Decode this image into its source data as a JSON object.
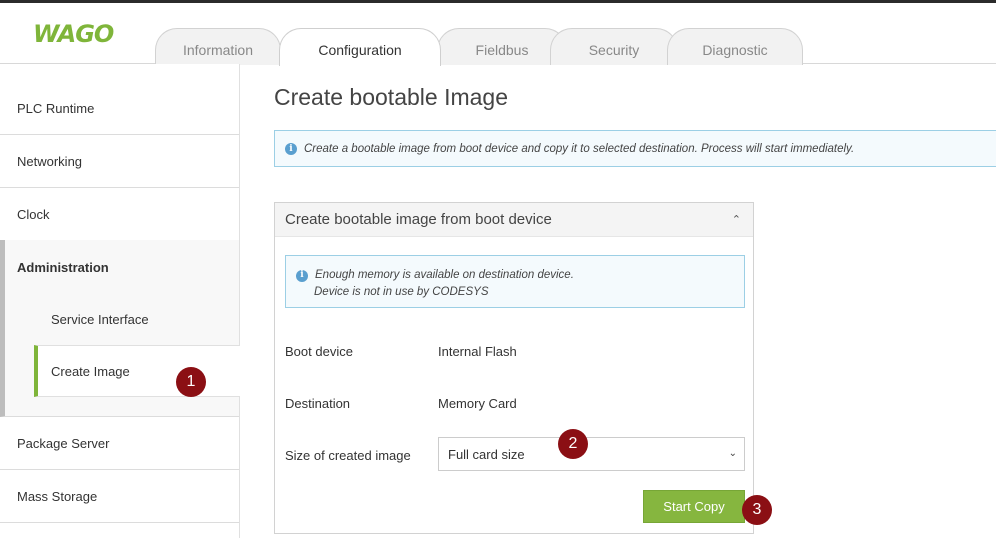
{
  "header": {
    "logo": "WAGO",
    "tabs": [
      {
        "label": "Information",
        "active": false
      },
      {
        "label": "Configuration",
        "active": true
      },
      {
        "label": "Fieldbus",
        "active": false
      },
      {
        "label": "Security",
        "active": false
      },
      {
        "label": "Diagnostic",
        "active": false
      }
    ]
  },
  "sidebar": {
    "items": [
      {
        "label": "PLC Runtime"
      },
      {
        "label": "Networking"
      },
      {
        "label": "Clock"
      },
      {
        "label": "Administration"
      },
      {
        "label": "Package Server"
      },
      {
        "label": "Mass Storage"
      }
    ],
    "admin_sub": [
      {
        "label": "Service Interface",
        "active": false
      },
      {
        "label": "Create Image",
        "active": true
      }
    ]
  },
  "main": {
    "title": "Create bootable Image",
    "info": "Create a bootable image from boot device and copy it to selected destination. Process will start immediately.",
    "panel": {
      "title": "Create bootable image from boot device",
      "info_lines": [
        "Enough memory is available on destination device.",
        "Device is not in use by CODESYS"
      ],
      "boot_device_label": "Boot device",
      "boot_device_value": "Internal Flash",
      "destination_label": "Destination",
      "destination_value": "Memory Card",
      "size_label": "Size of created image",
      "size_value": "Full card size",
      "start_button": "Start Copy"
    }
  },
  "markers": [
    "1",
    "2",
    "3"
  ],
  "colors": {
    "accent_green": "#7fb53a",
    "button_green": "#86b63f",
    "marker_red": "#8b0f14",
    "info_border": "#9ccfe5"
  }
}
